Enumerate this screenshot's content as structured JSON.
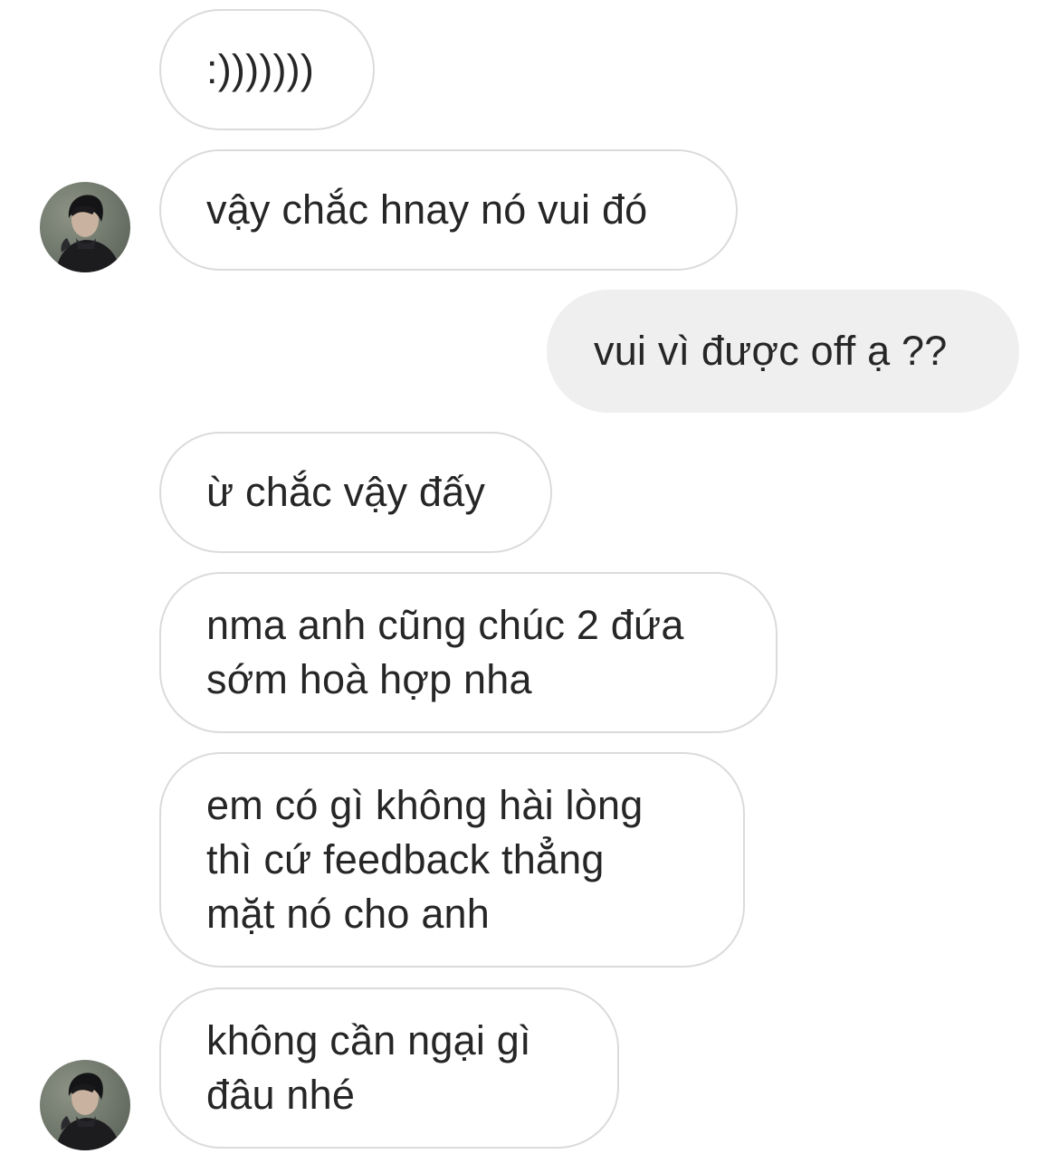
{
  "thread": {
    "messages": [
      {
        "id": "m1",
        "sender": "other",
        "text": ":)))))))"
      },
      {
        "id": "m2",
        "sender": "other",
        "text": "vậy chắc hnay nó vui đó"
      },
      {
        "id": "m3",
        "sender": "me",
        "text": "vui vì được off ạ ??"
      },
      {
        "id": "m4",
        "sender": "other",
        "text": "ừ chắc vậy đấy"
      },
      {
        "id": "m5",
        "sender": "other",
        "text": "nma anh cũng chúc 2 đứa\nsớm hoà hợp nha"
      },
      {
        "id": "m6",
        "sender": "other",
        "text": "em có gì không hài lòng\nthì cứ feedback thẳng\nmặt nó cho anh"
      },
      {
        "id": "m7",
        "sender": "other",
        "text": "không cần ngại gì\nđâu nhé"
      }
    ],
    "avatar_icon": "user-avatar-photo",
    "colors": {
      "incoming_bubble_border": "#dbdbdb",
      "outgoing_bubble_fill": "#efefef",
      "text": "#262626",
      "background": "#ffffff"
    }
  }
}
